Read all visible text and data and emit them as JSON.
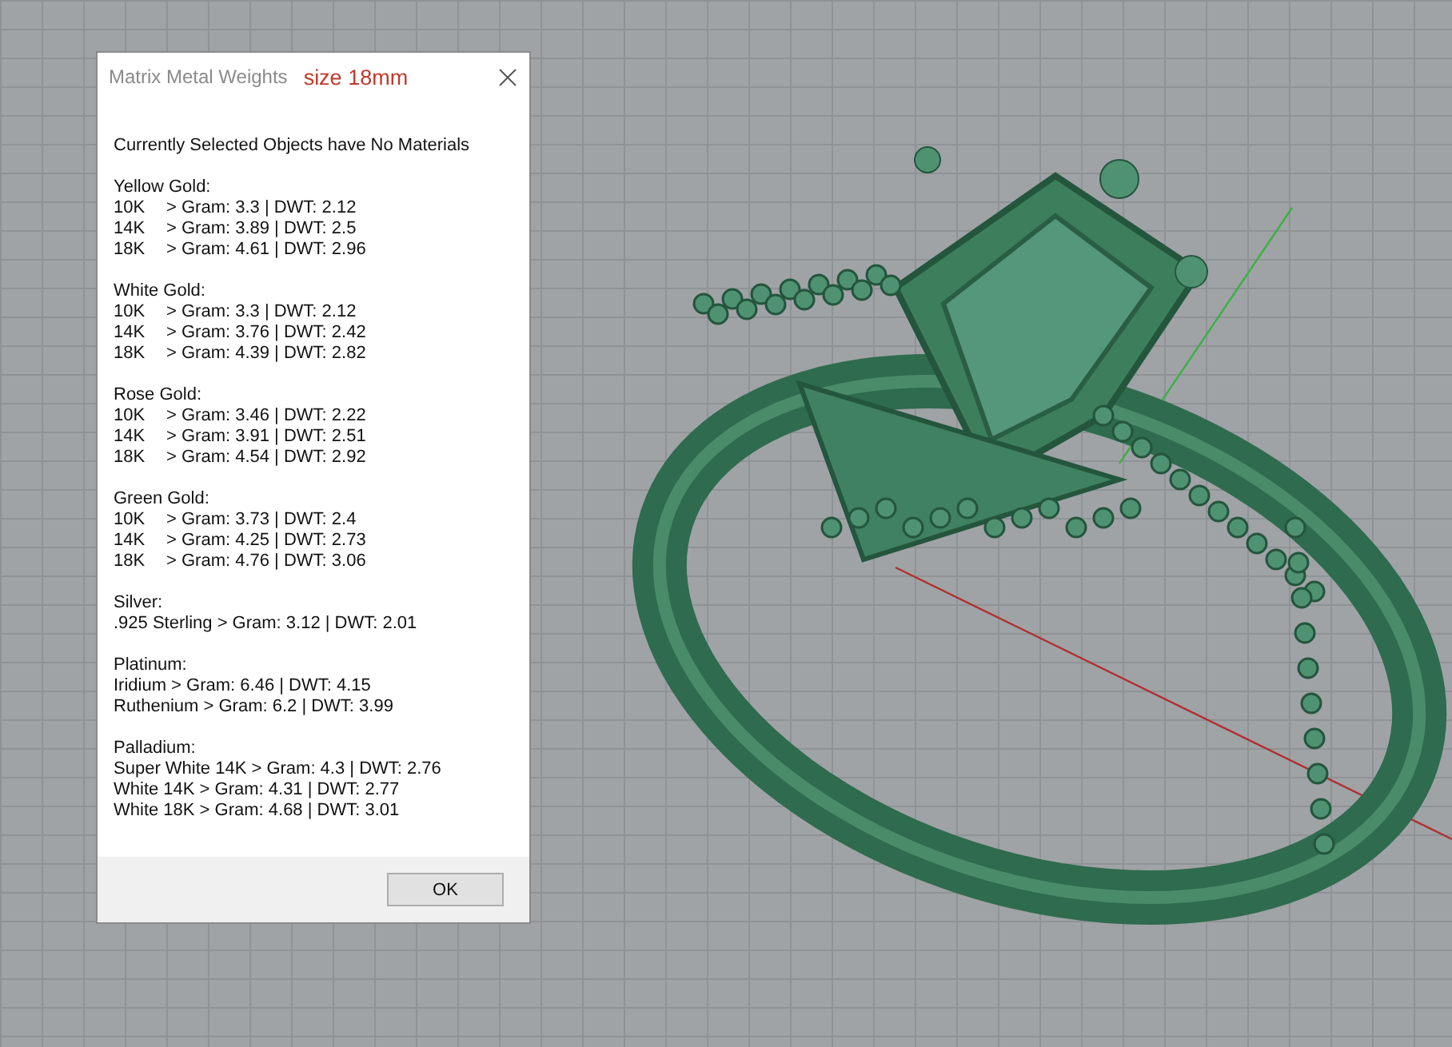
{
  "dialog": {
    "title": "Matrix Metal Weights",
    "annotation": "size 18mm",
    "message": "Currently Selected Objects have No Materials",
    "groups": [
      {
        "heading": "Yellow Gold:",
        "rows": [
          {
            "kind": "column",
            "label": "10K",
            "value": "> Gram: 3.3 | DWT: 2.12"
          },
          {
            "kind": "column",
            "label": "14K",
            "value": "> Gram: 3.89 | DWT: 2.5"
          },
          {
            "kind": "column",
            "label": "18K",
            "value": "> Gram: 4.61 | DWT: 2.96"
          }
        ]
      },
      {
        "heading": "White Gold:",
        "rows": [
          {
            "kind": "column",
            "label": "10K",
            "value": "> Gram: 3.3 | DWT: 2.12"
          },
          {
            "kind": "column",
            "label": "14K",
            "value": "> Gram: 3.76 | DWT: 2.42"
          },
          {
            "kind": "column",
            "label": "18K",
            "value": "> Gram: 4.39 | DWT: 2.82"
          }
        ]
      },
      {
        "heading": "Rose Gold:",
        "rows": [
          {
            "kind": "column",
            "label": "10K",
            "value": "> Gram: 3.46 | DWT: 2.22"
          },
          {
            "kind": "column",
            "label": "14K",
            "value": "> Gram: 3.91 | DWT: 2.51"
          },
          {
            "kind": "column",
            "label": "18K",
            "value": "> Gram: 4.54 | DWT: 2.92"
          }
        ]
      },
      {
        "heading": "Green Gold:",
        "rows": [
          {
            "kind": "column",
            "label": "10K",
            "value": "> Gram: 3.73 | DWT: 2.4"
          },
          {
            "kind": "column",
            "label": "14K",
            "value": "> Gram: 4.25 | DWT: 2.73"
          },
          {
            "kind": "column",
            "label": "18K",
            "value": "> Gram: 4.76 | DWT: 3.06"
          }
        ]
      },
      {
        "heading": "Silver:",
        "rows": [
          {
            "kind": "line",
            "text": ".925 Sterling > Gram: 3.12 | DWT: 2.01"
          }
        ]
      },
      {
        "heading": "Platinum:",
        "rows": [
          {
            "kind": "line",
            "text": "Iridium > Gram: 6.46 | DWT: 4.15"
          },
          {
            "kind": "line",
            "text": "Ruthenium > Gram: 6.2 | DWT: 3.99"
          }
        ]
      },
      {
        "heading": "Palladium:",
        "rows": [
          {
            "kind": "line",
            "text": "Super White 14K > Gram: 4.3 | DWT: 2.76"
          },
          {
            "kind": "line",
            "text": "White 14K > Gram: 4.31 | DWT: 2.77"
          },
          {
            "kind": "line",
            "text": "White 18K > Gram: 4.68 | DWT: 3.01"
          }
        ]
      }
    ],
    "button": "OK"
  }
}
